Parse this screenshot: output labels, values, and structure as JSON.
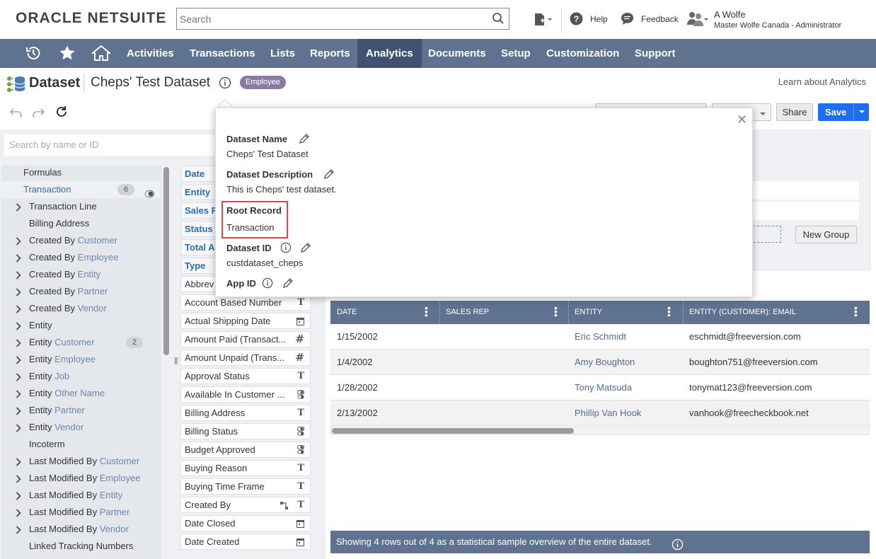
{
  "topbar": {
    "logo_oracle": "ORACLE",
    "logo_netsuite": "NETSUITE",
    "search_placeholder": "Search",
    "help": "Help",
    "feedback": "Feedback",
    "user_name": "A Wolfe",
    "user_role": "Master Wolfe Canada - Administrator"
  },
  "nav": {
    "items": [
      "Activities",
      "Transactions",
      "Lists",
      "Reports",
      "Analytics",
      "Documents",
      "Setup",
      "Customization",
      "Support"
    ],
    "active": "Analytics"
  },
  "header": {
    "title": "Dataset",
    "dataset_name": "Cheps' Test Dataset",
    "badge": "Employee",
    "learn_link": "Learn about Analytics"
  },
  "toolbar": {
    "share": "Share",
    "save": "Save"
  },
  "left": {
    "search_placeholder": "Search by name or ID",
    "tree": [
      {
        "prefix": "Formulas",
        "suffix": "",
        "chevron": false,
        "top": true
      },
      {
        "prefix": "Transaction",
        "suffix": "",
        "chevron": false,
        "top": true,
        "count": "6",
        "selected": true
      },
      {
        "prefix": "Transaction Line",
        "suffix": "",
        "chevron": true
      },
      {
        "prefix": "Billing Address",
        "suffix": "",
        "chevron": false
      },
      {
        "prefix": "Created By ",
        "suffix": "Customer",
        "chevron": true
      },
      {
        "prefix": "Created By ",
        "suffix": "Employee",
        "chevron": true
      },
      {
        "prefix": "Created By ",
        "suffix": "Entity",
        "chevron": true
      },
      {
        "prefix": "Created By ",
        "suffix": "Partner",
        "chevron": true
      },
      {
        "prefix": "Created By ",
        "suffix": "Vendor",
        "chevron": true
      },
      {
        "prefix": "Entity",
        "suffix": "",
        "chevron": true
      },
      {
        "prefix": "Entity ",
        "suffix": "Customer",
        "chevron": true,
        "count": "2"
      },
      {
        "prefix": "Entity ",
        "suffix": "Employee",
        "chevron": true
      },
      {
        "prefix": "Entity ",
        "suffix": "Job",
        "chevron": true
      },
      {
        "prefix": "Entity ",
        "suffix": "Other Name",
        "chevron": true
      },
      {
        "prefix": "Entity ",
        "suffix": "Partner",
        "chevron": true
      },
      {
        "prefix": "Entity ",
        "suffix": "Vendor",
        "chevron": true
      },
      {
        "prefix": "Incoterm",
        "suffix": "",
        "chevron": false
      },
      {
        "prefix": "Last Modified By ",
        "suffix": "Customer",
        "chevron": true
      },
      {
        "prefix": "Last Modified By ",
        "suffix": "Employee",
        "chevron": true
      },
      {
        "prefix": "Last Modified By ",
        "suffix": "Entity",
        "chevron": true
      },
      {
        "prefix": "Last Modified By ",
        "suffix": "Partner",
        "chevron": true
      },
      {
        "prefix": "Last Modified By ",
        "suffix": "Vendor",
        "chevron": true
      },
      {
        "prefix": "Linked Tracking Numbers",
        "suffix": "",
        "chevron": false
      }
    ],
    "fields": [
      {
        "label": "Date",
        "type": "",
        "selected": true
      },
      {
        "label": "Entity",
        "type": "",
        "selected": true
      },
      {
        "label": "Sales R",
        "type": "",
        "selected": true
      },
      {
        "label": "Status",
        "type": "",
        "selected": true
      },
      {
        "label": "Total A",
        "type": "",
        "selected": true
      },
      {
        "label": "Type",
        "type": "",
        "selected": true
      },
      {
        "label": "Abbrev",
        "type": "",
        "selected": false
      },
      {
        "label": "Account Based Number",
        "type": "T",
        "selected": false
      },
      {
        "label": "Actual Shipping Date",
        "type": "date",
        "selected": false
      },
      {
        "label": "Amount Paid (Transact...",
        "type": "#",
        "selected": false
      },
      {
        "label": "Amount Unpaid (Trans...",
        "type": "#",
        "selected": false
      },
      {
        "label": "Approval Status",
        "type": "T",
        "selected": false
      },
      {
        "label": "Available In Customer ...",
        "type": "bool",
        "selected": false
      },
      {
        "label": "Billing Address",
        "type": "T",
        "selected": false
      },
      {
        "label": "Billing Status",
        "type": "bool",
        "selected": false
      },
      {
        "label": "Budget Approved",
        "type": "bool",
        "selected": false
      },
      {
        "label": "Buying Reason",
        "type": "T",
        "selected": false
      },
      {
        "label": "Buying Time Frame",
        "type": "T",
        "selected": false
      },
      {
        "label": "Created By",
        "type": "T",
        "selected": false
      },
      {
        "label": "Date Closed",
        "type": "date",
        "selected": false
      },
      {
        "label": "Date Created",
        "type": "date",
        "selected": false
      }
    ]
  },
  "criteria": {
    "new_group": "New Group"
  },
  "grid": {
    "columns": [
      "DATE",
      "SALES REP",
      "ENTITY",
      "ENTITY (CUSTOMER): EMAIL"
    ],
    "rows": [
      [
        "1/15/2002",
        "",
        "Eric Schmidt",
        "eschmidt@freeversion.com"
      ],
      [
        "1/4/2002",
        "",
        "Amy Boughton",
        "boughton751@freeversion.com"
      ],
      [
        "1/28/2002",
        "",
        "Tony Matsuda",
        "tonymat123@freeversion.com"
      ],
      [
        "2/13/2002",
        "",
        "Phillip Van Hook",
        "vanhook@freecheckbook.net"
      ]
    ],
    "footer": "Showing 4 rows out of 4 as a statistical sample overview of the entire dataset."
  },
  "popover": {
    "name_label": "Dataset Name",
    "name_value": "Cheps' Test Dataset",
    "desc_label": "Dataset Description",
    "desc_value": "This is Cheps' test dataset.",
    "root_label": "Root Record",
    "root_value": "Transaction",
    "id_label": "Dataset ID",
    "id_value": "custdataset_cheps",
    "app_label": "App ID"
  },
  "colors": {
    "nav_bg": "#5f7390",
    "nav_active": "#3f5270",
    "save_blue": "#1e6ff0",
    "badge": "#8a7aa8",
    "highlight_red": "#e04646"
  }
}
